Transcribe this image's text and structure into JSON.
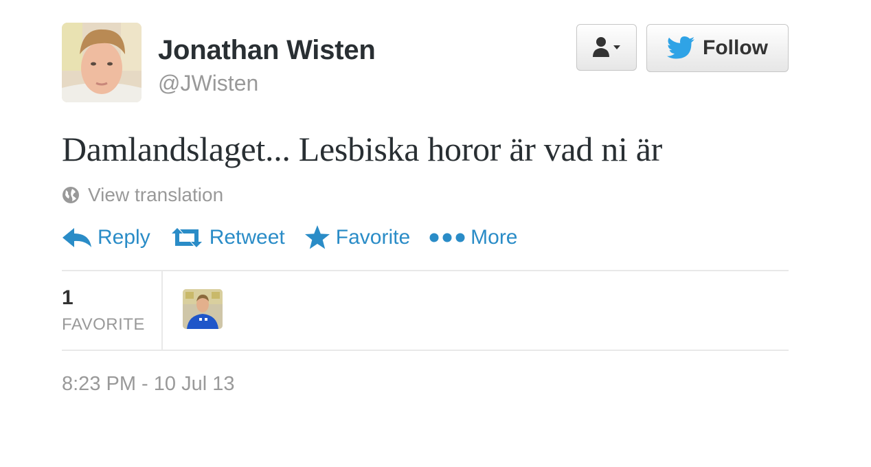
{
  "user": {
    "name": "Jonathan Wisten",
    "handle": "@JWisten"
  },
  "buttons": {
    "follow_label": "Follow"
  },
  "tweet": {
    "text": "Damlandslaget... Lesbiska horor är vad ni är",
    "view_translation": "View translation",
    "timestamp": "8:23 PM - 10 Jul 13"
  },
  "actions": [
    {
      "label": "Reply",
      "icon": "reply-icon"
    },
    {
      "label": "Retweet",
      "icon": "retweet-icon"
    },
    {
      "label": "Favorite",
      "icon": "star-icon"
    },
    {
      "label": "More",
      "icon": "more-dots-icon"
    }
  ],
  "stats": {
    "favorite_count": "1",
    "favorite_label": "FAVORITE"
  },
  "colors": {
    "link_blue": "#2a8cc7",
    "twitter_bird": "#2fa3e6",
    "muted_gray": "#999999"
  }
}
